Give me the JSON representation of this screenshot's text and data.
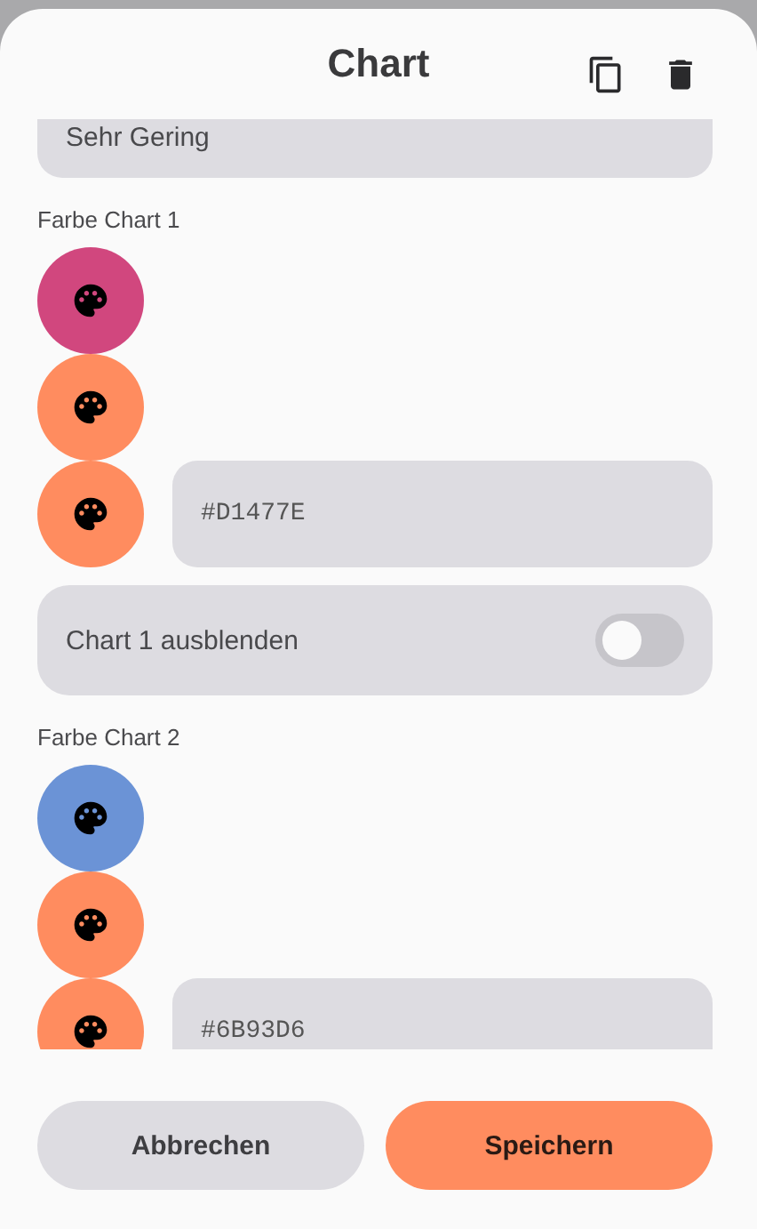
{
  "dialog": {
    "title": "Chart"
  },
  "field_top": {
    "value": "Sehr Gering"
  },
  "charts": [
    {
      "label": "Farbe Chart 1",
      "swatches": [
        {
          "color": "#d1477e"
        },
        {
          "color": "#ff8c5f"
        },
        {
          "color": "#ff8c5f"
        }
      ],
      "hex": "#D1477E",
      "toggle": {
        "label": "Chart 1 ausblenden",
        "on": false
      }
    },
    {
      "label": "Farbe Chart 2",
      "swatches": [
        {
          "color": "#6b93d6"
        },
        {
          "color": "#ff8c5f"
        },
        {
          "color": "#ff8c5f"
        }
      ],
      "hex": "#6B93D6"
    }
  ],
  "buttons": [
    {
      "label": "Abbrechen",
      "kind": "secondary"
    },
    {
      "label": "Speichern",
      "kind": "primary"
    }
  ]
}
